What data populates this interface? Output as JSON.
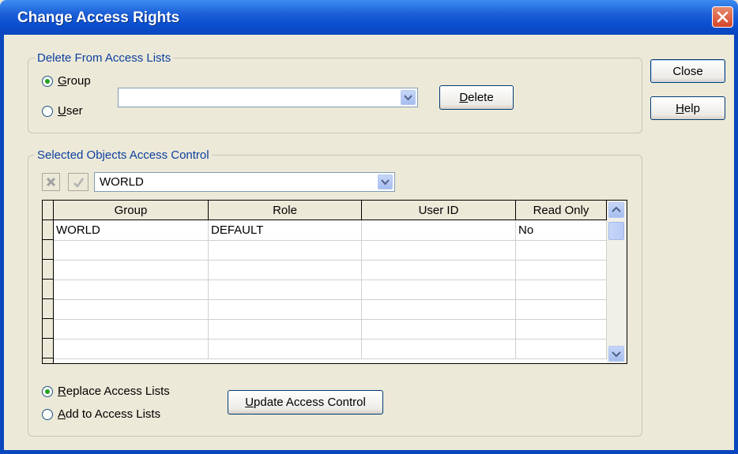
{
  "window": {
    "title": "Change Access Rights"
  },
  "delete_group": {
    "legend": "Delete From Access Lists",
    "radio_group": {
      "prefix": "",
      "u": "G",
      "rest": "roup",
      "checked": true
    },
    "radio_user": {
      "u": "U",
      "rest": "ser",
      "checked": false
    },
    "combo_value": "",
    "delete_button": {
      "u": "D",
      "rest": "elete"
    }
  },
  "side_buttons": {
    "close": "Close",
    "help": {
      "u": "H",
      "rest": "elp"
    }
  },
  "access_control": {
    "legend": "Selected Objects Access Control",
    "cancel_icon": "x-icon",
    "confirm_icon": "check-icon",
    "combo_value": "WORLD",
    "columns": [
      "Group",
      "Role",
      "User ID",
      "Read Only"
    ],
    "rows": [
      [
        "WORLD",
        "DEFAULT",
        "",
        "No"
      ],
      [
        "",
        "",
        "",
        ""
      ],
      [
        "",
        "",
        "",
        ""
      ],
      [
        "",
        "",
        "",
        ""
      ],
      [
        "",
        "",
        "",
        ""
      ],
      [
        "",
        "",
        "",
        ""
      ],
      [
        "",
        "",
        "",
        ""
      ]
    ],
    "radio_replace": {
      "u": "R",
      "rest": "eplace Access Lists",
      "checked": true
    },
    "radio_add": {
      "u": "A",
      "rest": "dd to Access Lists",
      "checked": false
    },
    "update_button": {
      "u": "U",
      "rest": "pdate Access Control"
    }
  },
  "colors": {
    "title_bar": "#0a46bd",
    "legend_text": "#0c3fa0",
    "dialog_bg": "#ece9d8"
  }
}
